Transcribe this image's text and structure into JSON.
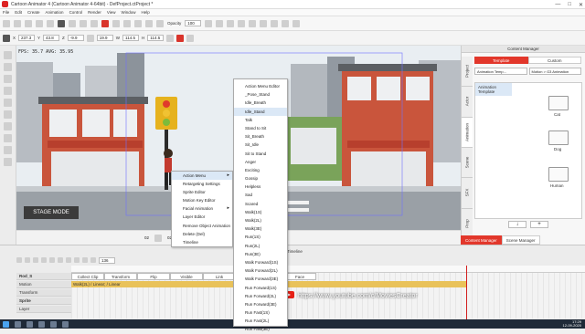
{
  "window": {
    "title": "Cartoon Animator 4 (Cartoon Animator 4-64bit) - DefProject.ctProject *",
    "controls": [
      "—",
      "□",
      "✕"
    ]
  },
  "menubar": [
    "File",
    "Edit",
    "Create",
    "Animation",
    "Control",
    "Render",
    "View",
    "Window",
    "Help"
  ],
  "toolbar": {
    "opacity_label": "Opacity",
    "opacity_value": "100",
    "x_label": "X",
    "x_value": "237.3",
    "y_label": "Y",
    "y_value": "43.8",
    "z_label": "Z",
    "z_value": "-9.9",
    "rot_value": "19.9",
    "w_label": "W",
    "w_value": "114.5",
    "h_label": "H",
    "h_value": "114.5"
  },
  "viewport": {
    "fps_text": "FPS: 35.7  AVG: 35.95",
    "stage_mode_label": "STAGE MODE",
    "slider_left": "02",
    "slider_right": "02"
  },
  "context_menu_main": {
    "items": [
      "Action Menu",
      "Retargeting Settings",
      "Sprite Editor",
      "Motion Key Editor",
      "Facial Animation",
      "Layer Editor",
      "Remove Object Animation",
      "Delete (Del)",
      "Timeline"
    ]
  },
  "context_menu_action": {
    "items": [
      "Action Menu Editor",
      "_Pose_Stand",
      "Idle_Breath",
      "Idle_Stand",
      "Talk",
      "Stand to Sit",
      "Sit_Breath",
      "Sit_Idle",
      "Sit to Stand",
      "Anger",
      "Exciting",
      "Gossip",
      "Helpless",
      "Sad",
      "Scared",
      "Walk(1S)",
      "Walk(2L)",
      "Walk(3E)",
      "Run(1S)",
      "Run(2L)",
      "Run(3E)",
      "Walk Forward(1S)",
      "Walk Forward(2L)",
      "Walk Forward(3E)",
      "Run Forward(1S)",
      "Run Forward(2L)",
      "Run Forward(3E)",
      "Run Fast(1S)",
      "Run Fast(2L)",
      "Run Fast(3E)"
    ],
    "highlighted_index": 3
  },
  "content_manager": {
    "title": "Content Manager",
    "tabs": [
      "Template",
      "Custom"
    ],
    "active_tab": "Template",
    "side_tabs": [
      "Project",
      "Actor",
      "Animation",
      "Scene",
      "SFX",
      "Prop"
    ],
    "dropdown_left": "Animation Temp...",
    "dropdown_right": "Motion > G3 Animation",
    "tree_item": "Animation Template",
    "folders": [
      "Cat",
      "Dog",
      "Human"
    ],
    "bottom_buttons": [
      "↓",
      "+"
    ]
  },
  "bottom_tabs": [
    "Content Manager",
    "Scene Manager"
  ],
  "timeline": {
    "title": "Timeline",
    "frame_field": "136",
    "rows": [
      "Rod_S",
      "Motion",
      "Transform",
      "Sprite",
      "Layer"
    ],
    "headers": [
      "Collect Clip",
      "Transform",
      "Flip",
      "Visible",
      "Link",
      "Face"
    ],
    "motion_clip_label": "Walk(2L) / Linear; / Linear",
    "playhead_frame": 136,
    "total_frames": 190
  },
  "watermark": {
    "url": "https://www.youtube.com/c/MoviesCreator"
  },
  "taskbar": {
    "time": "17:29",
    "date": "12-09-2020"
  },
  "colors": {
    "accent_red": "#e2372b",
    "motion_clip": "#e9c25a",
    "selection_blue": "#dbe8f6"
  }
}
